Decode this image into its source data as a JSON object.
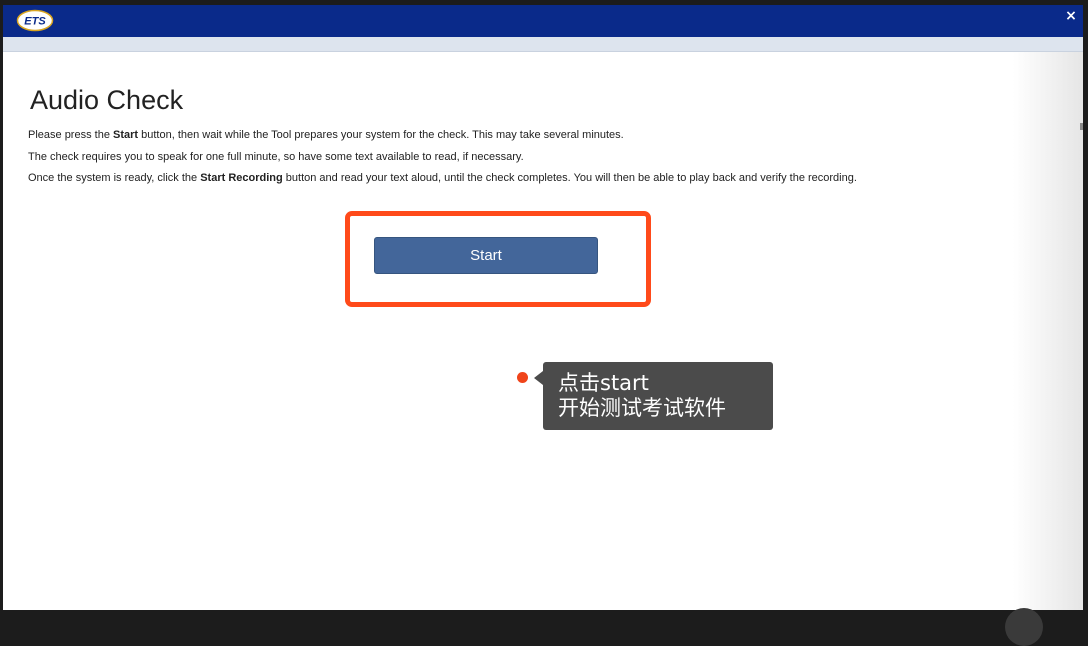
{
  "app": {
    "logo_text": "ETS",
    "close_label": "×"
  },
  "page": {
    "title": "Audio Check",
    "lines": [
      {
        "pre": "Please press the ",
        "bold": "Start",
        "post": " button, then wait while the Tool prepares your system for the check. This may take several minutes."
      },
      {
        "text": "The check requires you to speak for one full minute, so have some text available to read, if necessary."
      },
      {
        "pre": "Once the system is ready, click the ",
        "bold": "Start Recording",
        "post": " button and read your text aloud, until the check completes. You will then be able to play back and verify the recording."
      }
    ],
    "start_button": "Start"
  },
  "annotation": {
    "line1": "点击start",
    "line2": "开始测试考试软件"
  },
  "colors": {
    "titlebar": "#0a2a8a",
    "button": "#43669a",
    "highlight": "#ff4a1a",
    "tooltip_bg": "#4b4b4b",
    "logo_gold": "#d9a520"
  }
}
